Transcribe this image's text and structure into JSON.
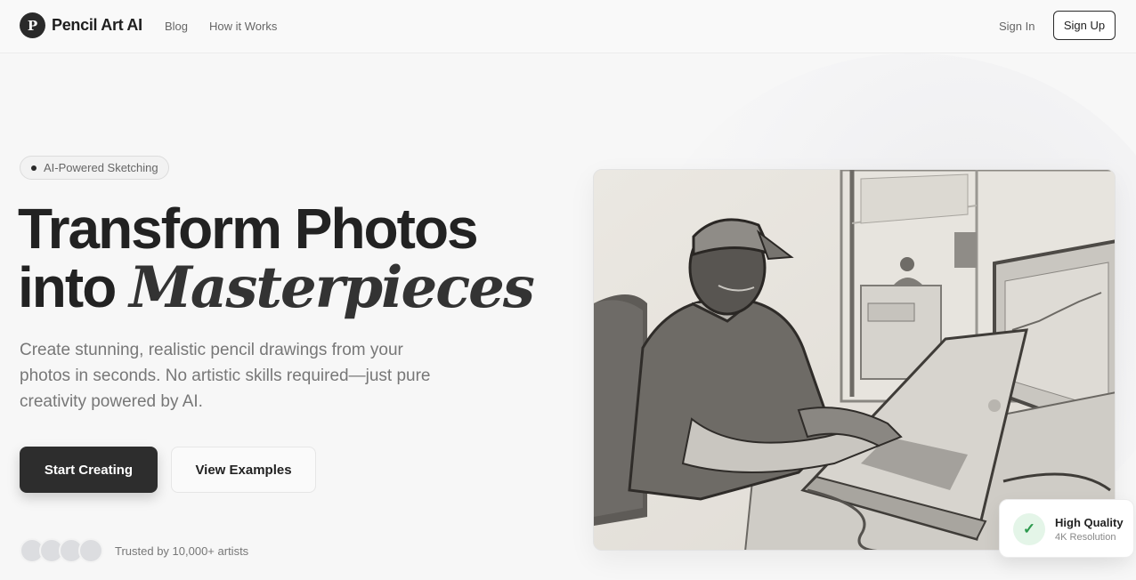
{
  "header": {
    "logo_letter": "P",
    "brand": "Pencil Art AI",
    "nav": [
      {
        "label": "Blog"
      },
      {
        "label": "How it Works"
      }
    ],
    "sign_in": "Sign In",
    "sign_up": "Sign Up"
  },
  "hero": {
    "badge": "AI-Powered Sketching",
    "headline_line1": "Transform Photos",
    "headline_line2_plain": "into ",
    "headline_line2_accent": "Masterpieces",
    "subtitle": "Create stunning, realistic pencil drawings from your photos in seconds. No artistic skills required—just pure creativity powered by AI.",
    "primary_cta": "Start Creating",
    "secondary_cta": "View Examples",
    "trust_text": "Trusted by 10,000+ artists",
    "avatar_count": 4
  },
  "showcase": {
    "image_icon": "pencil-sketch-man-laptop-image",
    "quality_title": "High Quality",
    "quality_subtitle": "4K Resolution",
    "quality_icon": "check-icon"
  },
  "colors": {
    "primary": "#2d2d2d",
    "background": "#f7f7f7",
    "success": "#2e9a4f"
  }
}
